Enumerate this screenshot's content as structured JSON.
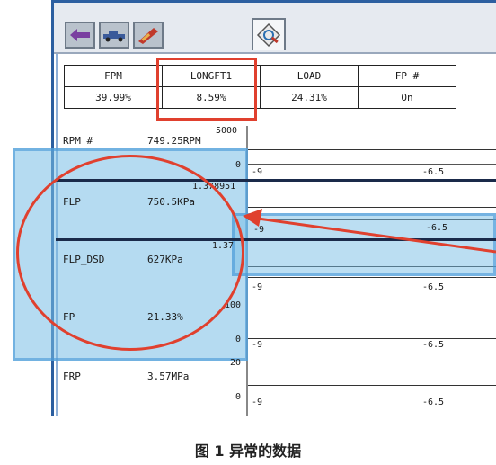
{
  "toolbar": {
    "buttons": [
      {
        "icon": "connector-icon"
      },
      {
        "icon": "car-icon"
      },
      {
        "icon": "tools-icon"
      }
    ],
    "active_tab_icon": "scan-tool-icon"
  },
  "pid_table": {
    "headers": [
      "FPM",
      "LONGFT1",
      "LOAD",
      "FP #"
    ],
    "values": [
      "39.99%",
      "8.59%",
      "24.31%",
      "On"
    ]
  },
  "rows": [
    {
      "name": "RPM #",
      "value": "749.25RPM",
      "scale_top": "5000",
      "scale_bottom": "0",
      "tick_left": "-9",
      "tick_mid": "-6.5"
    },
    {
      "name": "FLP",
      "value": "750.5KPa",
      "scale_top": "1.378951",
      "scale_bottom": "",
      "tick_left": "-9",
      "tick_mid": "-6.5"
    },
    {
      "name": "FLP_DSD",
      "value": "627KPa",
      "scale_top": "1.37",
      "scale_bottom": "",
      "tick_left": "-9",
      "tick_mid": "-6.5"
    },
    {
      "name": "FP",
      "value": "21.33%",
      "scale_top": "100",
      "scale_bottom": "0",
      "tick_left": "-9",
      "tick_mid": "-6.5"
    },
    {
      "name": "FRP",
      "value": "3.57MPa",
      "scale_top": "20",
      "scale_bottom": "0",
      "tick_left": "-9",
      "tick_mid": "-6.5"
    }
  ],
  "caption": "图 1 异常的数据",
  "colors": {
    "highlight": "#e0402e",
    "selection": "#78bee6",
    "frame": "#2c5fa0"
  }
}
